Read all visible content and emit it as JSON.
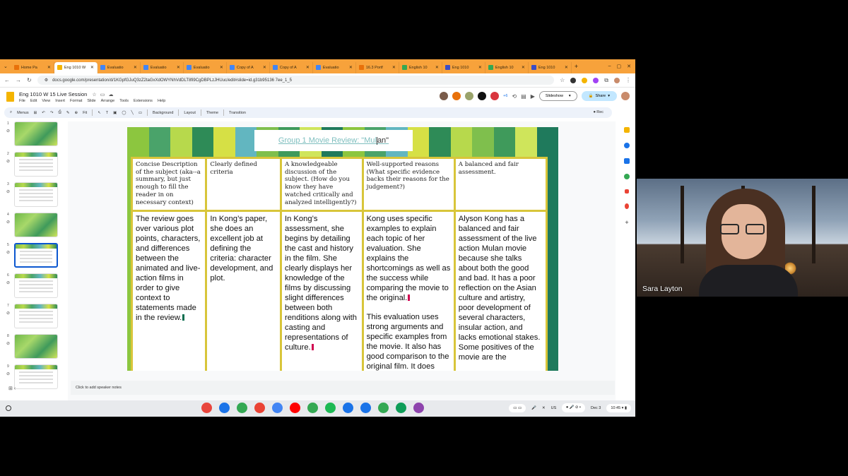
{
  "browser": {
    "tabs": [
      {
        "label": "Home Pa",
        "color": "#e8710a"
      },
      {
        "label": "Eng 1010 W",
        "color": "#f4b400",
        "active": true
      },
      {
        "label": "Evaluatio",
        "color": "#4285f4"
      },
      {
        "label": "Evaluatio",
        "color": "#4285f4"
      },
      {
        "label": "Evaluatio",
        "color": "#4285f4"
      },
      {
        "label": "Copy of A",
        "color": "#4285f4"
      },
      {
        "label": "Copy of A",
        "color": "#4285f4"
      },
      {
        "label": "Evaluatio",
        "color": "#4285f4"
      },
      {
        "label": "16.3 Portf",
        "color": "#e8710a"
      },
      {
        "label": "English 10",
        "color": "#34a853"
      },
      {
        "label": "Eng 1010",
        "color": "#3c4dc4"
      },
      {
        "label": "English 10",
        "color": "#34a853"
      },
      {
        "label": "Eng 1010",
        "color": "#3c4dc4"
      }
    ],
    "url": "docs.google.com/presentation/d/1KGpfGJuQ3zZ2taGxXdOWYNhVdDLT8fi9CgDBPLzJHUuc/edit#slide=id.g31b95136 7ee_1_5"
  },
  "doc": {
    "title": "Eng 1010 W 15 Live Session",
    "menu": [
      "File",
      "Edit",
      "View",
      "Insert",
      "Format",
      "Slide",
      "Arrange",
      "Tools",
      "Extensions",
      "Help"
    ],
    "collab_count": "+6",
    "slideshow_label": "Slideshow",
    "share_label": "Share"
  },
  "toolbar": {
    "menus_label": "Menus",
    "zoom": "Fit",
    "background": "Background",
    "layout": "Layout",
    "theme": "Theme",
    "transition": "Transition",
    "rec": "Rec"
  },
  "filmstrip": {
    "slides": [
      "1",
      "2",
      "3",
      "4",
      "5",
      "6",
      "7",
      "8",
      "9"
    ],
    "selected": "5"
  },
  "slide": {
    "title_prefix": "Group 1 Movie Review: \"Mul",
    "title_suffix": "an\"",
    "stripe_colors": [
      "#8cc63f",
      "#4aa36a",
      "#b7d94c",
      "#2e8b57",
      "#d6e045",
      "#62b6c0",
      "#7fbf4d",
      "#3f9a5b",
      "#cfe55b",
      "#1f7a5c",
      "#8cc63f",
      "#4aa36a",
      "#62b6c0",
      "#d6e045",
      "#2e8b57",
      "#b7d94c",
      "#7fbf4d",
      "#3f9a5b",
      "#cfe55b",
      "#1f7a5c"
    ],
    "criteria": [
      "Concise Description of the subject (aka--a summary, but just enough to fill the reader in on necessary context)",
      "Clearly defined criteria",
      "A knowledgeable discussion of the subject. (How do you know they have watched critically and analyzed intelligently?)",
      "Well-supported reasons (What specific evidence backs their reasons for the judgement?)",
      "A balanced and fair assessment."
    ],
    "evaluations": [
      "The review goes over various plot points, characters, and differences between the animated and live-action films in order to give context to statements made in the review.",
      "In Kong’s paper, she does an excellent job at defining the criteria: character development, and plot.",
      "In Kong’s assessment, she begins by detailing the cast and history in the film. She clearly displays her knowledge of the films by discussing slight differences between both renditions along with casting and representations of culture.",
      "Kong uses specific examples to explain each topic of her evaluation. She explains the shortcomings as well as the success while comparing the movie to the original.",
      "Alyson Kong has a balanced and fair assessment of the live action Mulan movie because she talks about both the good and bad. It has a poor reflection on the Asian culture and artistry, poor development of several characters, insular action, and lacks emotional stakes. Some positives of the movie are the"
    ],
    "evaluation_4_para2": "This evaluation uses strong arguments and specific examples from the movie. It also has good comparison to the original film. It does"
  },
  "notes": {
    "placeholder": "Click to add speaker notes"
  },
  "taskbar": {
    "apps": [
      "#e8453c",
      "#1a73e8",
      "#34a853",
      "#ea4335",
      "#4285f4",
      "#ff0000",
      "#34a853",
      "#1db954",
      "#1a73e8",
      "#1a73e8",
      "#34a853",
      "#0f9d58",
      "#8e44ad"
    ],
    "locale": "US",
    "date": "Dec 3",
    "time": "10:45"
  },
  "video": {
    "speaker_name": "Sara Layton"
  }
}
